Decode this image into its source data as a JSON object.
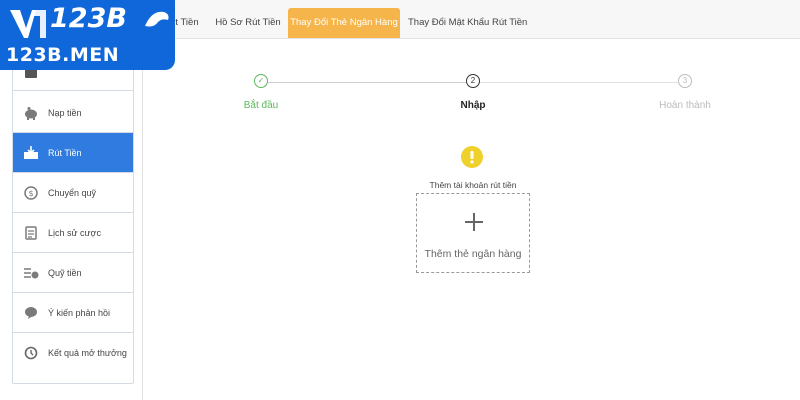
{
  "logo": {
    "text": "123B",
    "domain": "123B.MEN"
  },
  "tabs": [
    {
      "label": "t Tiền",
      "active": false
    },
    {
      "label": "Hồ Sơ Rút Tiền",
      "active": false
    },
    {
      "label": "Thay Đổi Thẻ Ngân Hàng",
      "active": true
    },
    {
      "label": "Thay Đổi Mật Khẩu Rút Tiền",
      "active": false
    }
  ],
  "sidebar": {
    "items": [
      {
        "label": "Nạp tiền",
        "icon": "piggy-bank-icon",
        "active": false
      },
      {
        "label": "Rút Tiền",
        "icon": "withdraw-icon",
        "active": true
      },
      {
        "label": "Chuyển quỹ",
        "icon": "transfer-icon",
        "active": false
      },
      {
        "label": "Lịch sử cược",
        "icon": "history-list-icon",
        "active": false
      },
      {
        "label": "Quỹ tiền",
        "icon": "fund-icon",
        "active": false
      },
      {
        "label": "Ý kiến phản hồi",
        "icon": "feedback-icon",
        "active": false
      },
      {
        "label": "Kết quả mở thưởng",
        "icon": "clock-history-icon",
        "active": false
      }
    ]
  },
  "stepper": {
    "steps": [
      {
        "number": "✓",
        "label": "Bắt đầu",
        "state": "done"
      },
      {
        "number": "2",
        "label": "Nhập",
        "state": "current"
      },
      {
        "number": "3",
        "label": "Hoàn thành",
        "state": "pending"
      }
    ]
  },
  "content": {
    "notice": "Thêm tài khoản rút tiền",
    "add_card_label": "Thêm thẻ ngân hàng"
  },
  "colors": {
    "brand": "#0f67d9",
    "active_tab": "#f5b54a",
    "active_sidebar": "#2f7be0",
    "done_step": "#5cb85c",
    "warning": "#f0d02a"
  }
}
